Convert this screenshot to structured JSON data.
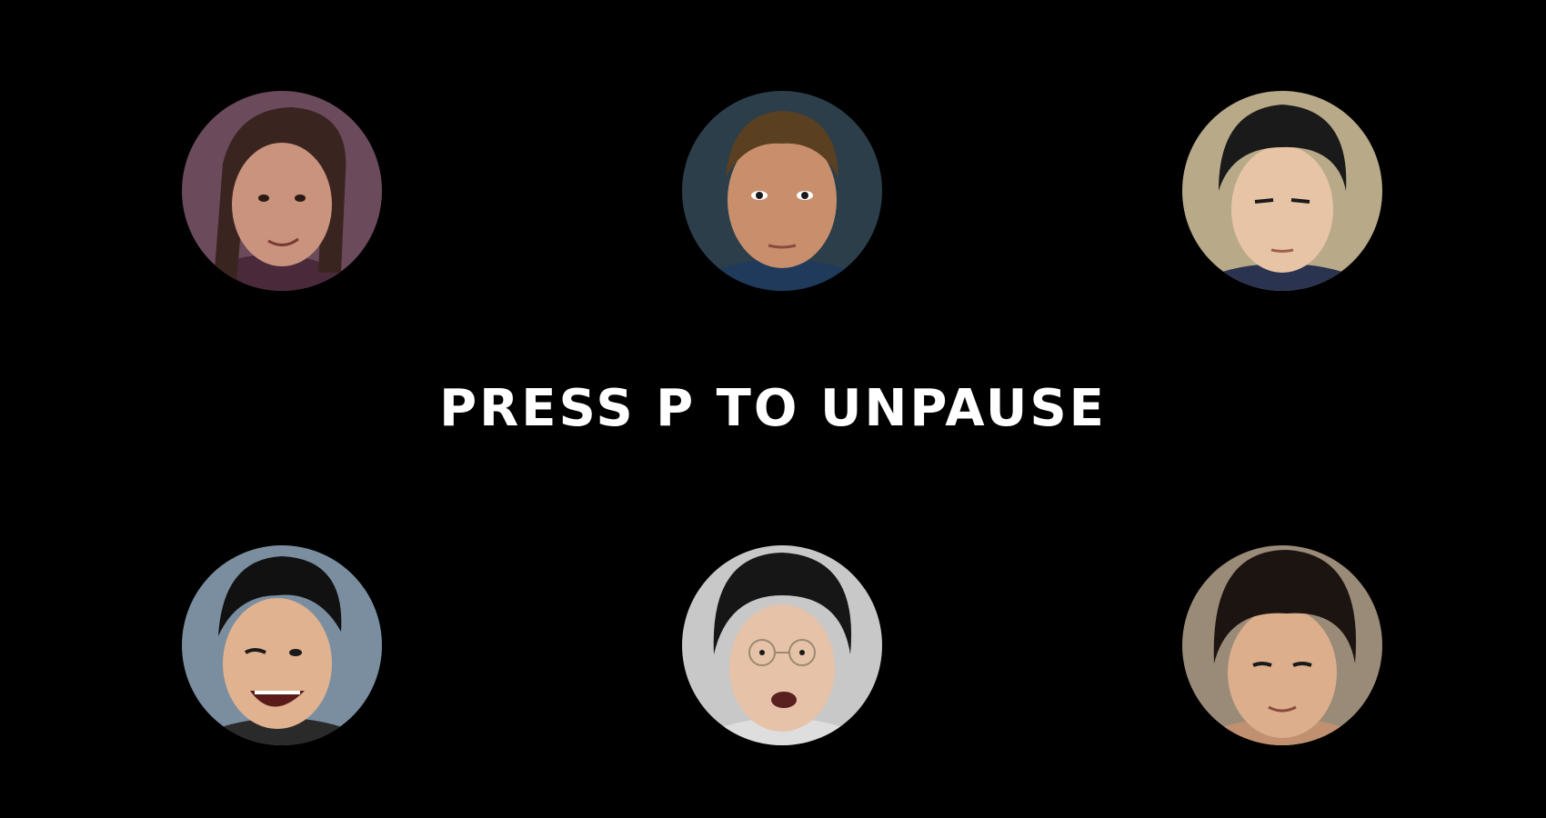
{
  "screen": {
    "background": "#000000",
    "state": "paused"
  },
  "pause_overlay": {
    "message": "PRESS P TO UNPAUSE",
    "color": "#ffffff"
  },
  "avatars": [
    {
      "icon": "player-portrait-icon",
      "palette": {
        "bg": "#6b4a5c",
        "skin": "#c9937e",
        "hair": "#3a2420",
        "shirt": "#4a2a3a"
      }
    },
    {
      "icon": "player-portrait-icon",
      "palette": {
        "bg": "#2c3e4a",
        "skin": "#c98f6d",
        "hair": "#5a4020",
        "shirt": "#1f3a5a"
      }
    },
    {
      "icon": "player-portrait-icon",
      "palette": {
        "bg": "#b8aa88",
        "skin": "#e8c4a6",
        "hair": "#1a1a1a",
        "shirt": "#2a3450"
      }
    },
    {
      "icon": "player-portrait-icon",
      "palette": {
        "bg": "#7a8ea0",
        "skin": "#e0b290",
        "hair": "#111111",
        "shirt": "#2a2a2a"
      }
    },
    {
      "icon": "player-portrait-icon",
      "palette": {
        "bg": "#c8c8c8",
        "skin": "#e6c2a8",
        "hair": "#161616",
        "shirt": "#dedede"
      }
    },
    {
      "icon": "player-portrait-icon",
      "palette": {
        "bg": "#9a8a78",
        "skin": "#dcae8c",
        "hair": "#1c1410",
        "shirt": "#c09070"
      }
    }
  ]
}
